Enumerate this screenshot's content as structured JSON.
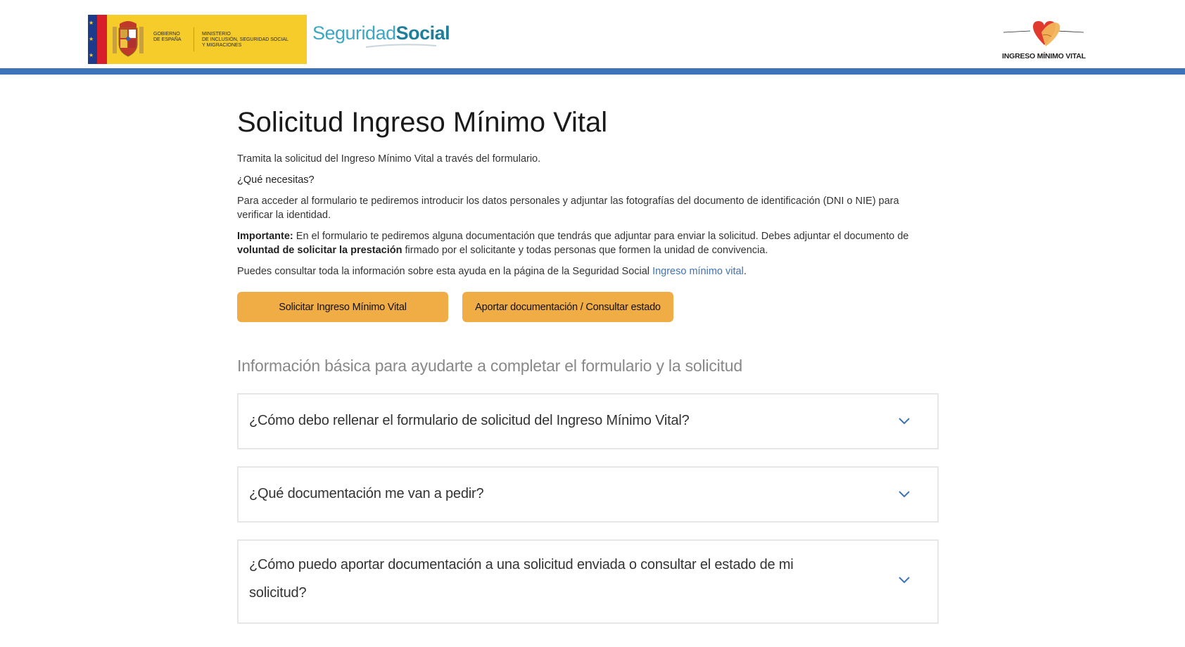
{
  "header": {
    "gov_logo": {
      "line1": "GOBIERNO",
      "line2": "DE ESPAÑA",
      "ministry_line1": "MINISTERIO",
      "ministry_line2": "DE INCLUSIÓN, SEGURIDAD SOCIAL",
      "ministry_line3": "Y MIGRACIONES"
    },
    "ss_logo": {
      "light": "Seguridad",
      "bold": "Social"
    },
    "imv_logo": {
      "text": "INGRESO MÍNIMO VITAL"
    },
    "colors": {
      "gov_yellow": "#f5cc2a",
      "blue_bar": "#3d73b8",
      "ss_light": "#3ea7c3",
      "ss_bold": "#1f7f9b"
    }
  },
  "main": {
    "title": "Solicitud Ingreso Mínimo Vital",
    "intro": "Tramita la solicitud del Ingreso Mínimo Vital a través del formulario.",
    "needs_heading": "¿Qué necesitas?",
    "needs_text": "Para acceder al formulario te pediremos introducir los datos personales y adjuntar las fotografías del documento de identificación (DNI o NIE) para verificar la identidad.",
    "important": {
      "label": "Importante:",
      "text_before": " En el formulario te pediremos alguna documentación que tendrás que adjuntar para enviar la solicitud. Debes adjuntar el documento de ",
      "strong": "voluntad de solicitar la prestación",
      "text_after": " firmado por el solicitante y todas personas que formen la unidad de convivencia."
    },
    "info": {
      "text_before": "Puedes consultar toda la información sobre esta ayuda en la página de la Seguridad Social ",
      "link": "Ingreso mínimo vital",
      "text_after": "."
    },
    "buttons": {
      "apply": "Solicitar Ingreso Mínimo Vital",
      "provide_docs": "Aportar documentación / Consultar estado"
    },
    "section_heading": "Información básica para ayudarte a completar el formulario y la solicitud",
    "faq": [
      {
        "question": "¿Cómo debo rellenar el formulario de solicitud del Ingreso Mínimo Vital?",
        "icon": "chevron-down-icon"
      },
      {
        "question": "¿Qué documentación me van a pedir?",
        "icon": "chevron-down-icon"
      },
      {
        "question": "¿Cómo puedo aportar documentación a una solicitud enviada o consultar el estado de mi solicitud?",
        "icon": "chevron-down-icon"
      }
    ],
    "colors": {
      "button_bg": "#f0ac45",
      "link": "#3d73b8",
      "chevron": "#3d73b8"
    }
  }
}
